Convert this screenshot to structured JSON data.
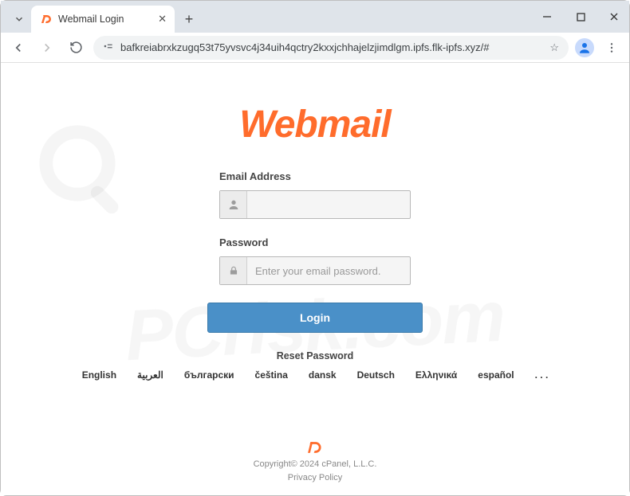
{
  "window": {
    "tab_title": "Webmail Login",
    "url": "bafkreiabrxkzugq53t75yvsvc4j34uih4qctry2kxxjchhajelzjimdlgm.ipfs.flk-ipfs.xyz/#"
  },
  "page": {
    "brand": "Webmail",
    "email_label": "Email Address",
    "email_value": "",
    "password_label": "Password",
    "password_placeholder": "Enter your email password.",
    "login_button": "Login",
    "reset_link": "Reset Password",
    "languages": [
      "English",
      "العربية",
      "български",
      "čeština",
      "dansk",
      "Deutsch",
      "Ελληνικά",
      "español",
      ". . ."
    ]
  },
  "footer": {
    "copyright": "Copyright© 2024 cPanel, L.L.C.",
    "privacy": "Privacy Policy"
  },
  "watermark": "PCrisk.com"
}
